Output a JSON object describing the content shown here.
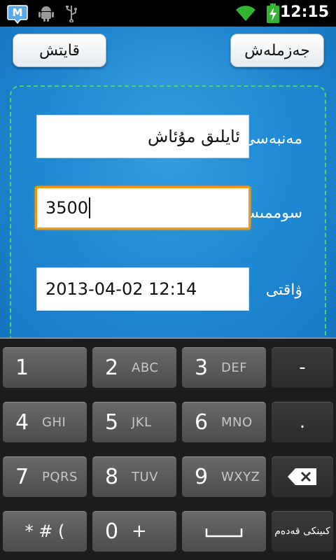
{
  "status_bar": {
    "time": "12:15",
    "icons": [
      "app-notification-icon",
      "android-debug-icon",
      "usb-icon",
      "wifi-icon",
      "battery-charging-icon"
    ]
  },
  "toolbar": {
    "back_label": "قايتش",
    "save_label": "جەزملەش"
  },
  "form": {
    "title_label": "مەنبەسى",
    "title_value": "ئايلىق مۇئاش",
    "amount_label": "سوممىسى",
    "amount_value": "3500",
    "time_label": "ۋاقتى",
    "time_value": "2013-04-02 12:14"
  },
  "keyboard": {
    "keys": [
      {
        "num": "1",
        "sub": ""
      },
      {
        "num": "2",
        "sub": "ABC"
      },
      {
        "num": "3",
        "sub": "DEF"
      },
      {
        "num": "-",
        "sub": ""
      },
      {
        "num": "4",
        "sub": "GHI"
      },
      {
        "num": "5",
        "sub": "JKL"
      },
      {
        "num": "6",
        "sub": "MNO"
      },
      {
        "num": ".",
        "sub": ""
      },
      {
        "num": "7",
        "sub": "PQRS"
      },
      {
        "num": "8",
        "sub": "TUV"
      },
      {
        "num": "9",
        "sub": "WXYZ"
      },
      {
        "num": "",
        "sub": ""
      },
      {
        "num": "* # (",
        "sub": ""
      },
      {
        "num": "0",
        "sub": "+"
      },
      {
        "num": "",
        "sub": ""
      },
      {
        "num": "كىينكى قەدەم",
        "sub": ""
      }
    ]
  },
  "colors": {
    "app_background": "#1f86cf",
    "panel_border": "#46d66a",
    "focus_border": "#f39a1a",
    "keyboard_background": "#1d1d1d"
  }
}
